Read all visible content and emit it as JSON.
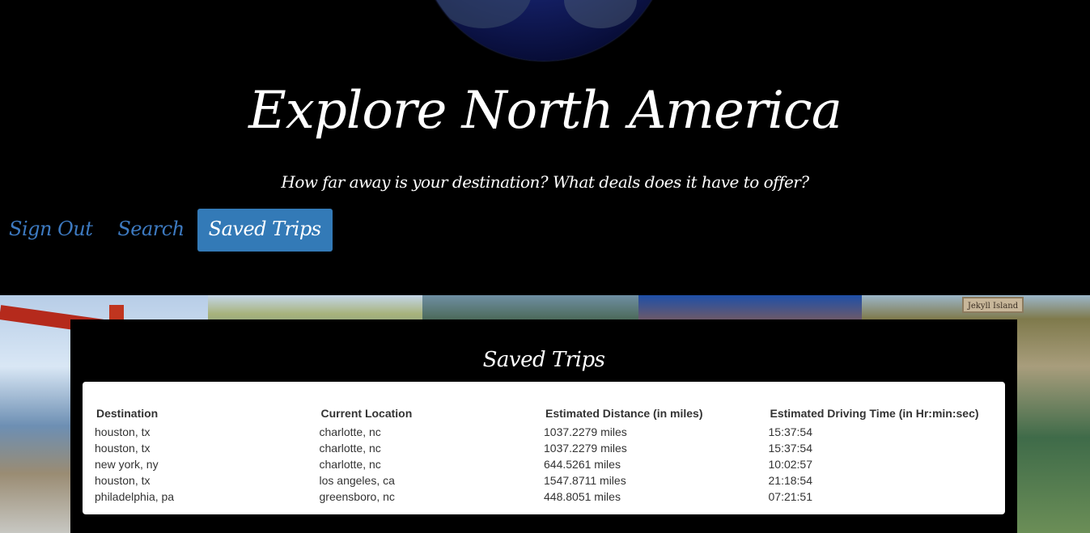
{
  "header": {
    "title": "Explore North America",
    "tagline": "How far away is your destination? What deals does it have to offer?"
  },
  "nav": {
    "items": [
      {
        "label": "Sign Out",
        "active": false
      },
      {
        "label": "Search",
        "active": false
      },
      {
        "label": "Saved Trips",
        "active": true
      }
    ]
  },
  "collage": {
    "jekyll_sign": "Jekyll Island"
  },
  "saved_trips": {
    "title": "Saved Trips",
    "columns": [
      "Destination",
      "Current Location",
      "Estimated Distance (in miles)",
      "Estimated Driving Time (in Hr:min:sec)"
    ],
    "rows": [
      [
        "houston, tx",
        "charlotte, nc",
        "1037.2279 miles",
        "15:37:54"
      ],
      [
        "houston, tx",
        "charlotte, nc",
        "1037.2279 miles",
        "15:37:54"
      ],
      [
        "new york, ny",
        "charlotte, nc",
        "644.5261 miles",
        "10:02:57"
      ],
      [
        "houston, tx",
        "los angeles, ca",
        "1547.8711 miles",
        "21:18:54"
      ],
      [
        "philadelphia, pa",
        "greensboro, nc",
        "448.8051 miles",
        "07:21:51"
      ]
    ]
  },
  "colors": {
    "background": "#000000",
    "nav_link": "#3d7ac1",
    "nav_active_bg": "#337ab7",
    "table_text": "#333333"
  }
}
